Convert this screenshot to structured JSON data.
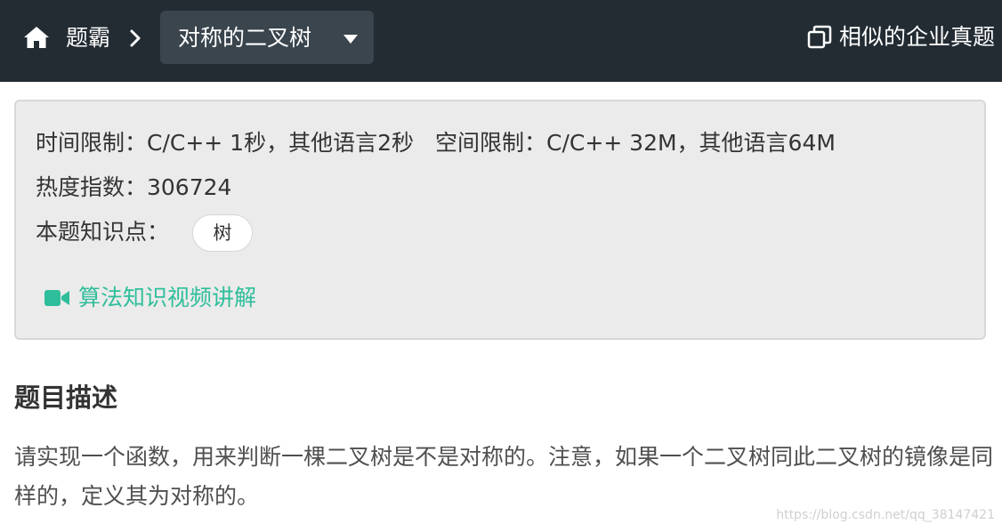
{
  "header": {
    "breadcrumb_root": "题霸",
    "dropdown_label": "对称的二叉树",
    "similar_label": "相似的企业真题"
  },
  "info": {
    "time_limit": "时间限制：C/C++ 1秒，其他语言2秒",
    "memory_limit": "空间限制：C/C++ 32M，其他语言64M",
    "heat": "热度指数：306724",
    "knowledge_label": "本题知识点：",
    "knowledge_tag": "树",
    "video_link": "算法知识视频讲解"
  },
  "problem": {
    "section_title": "题目描述",
    "description": "请实现一个函数，用来判断一棵二叉树是不是对称的。注意，如果一个二叉树同此二叉树的镜像是同样的，定义其为对称的。"
  },
  "watermark": "https://blog.csdn.net/qq_38147421",
  "colors": {
    "topbar": "#232c33",
    "dropdown": "#3a454e",
    "accent": "#2fbe9b",
    "panel": "#ebebeb"
  },
  "icons": {
    "home": "home-icon",
    "breadcrumb_separator": "chevron-right-icon",
    "dropdown_caret": "caret-down-icon",
    "similar": "copy-icon",
    "video": "video-camera-icon"
  }
}
